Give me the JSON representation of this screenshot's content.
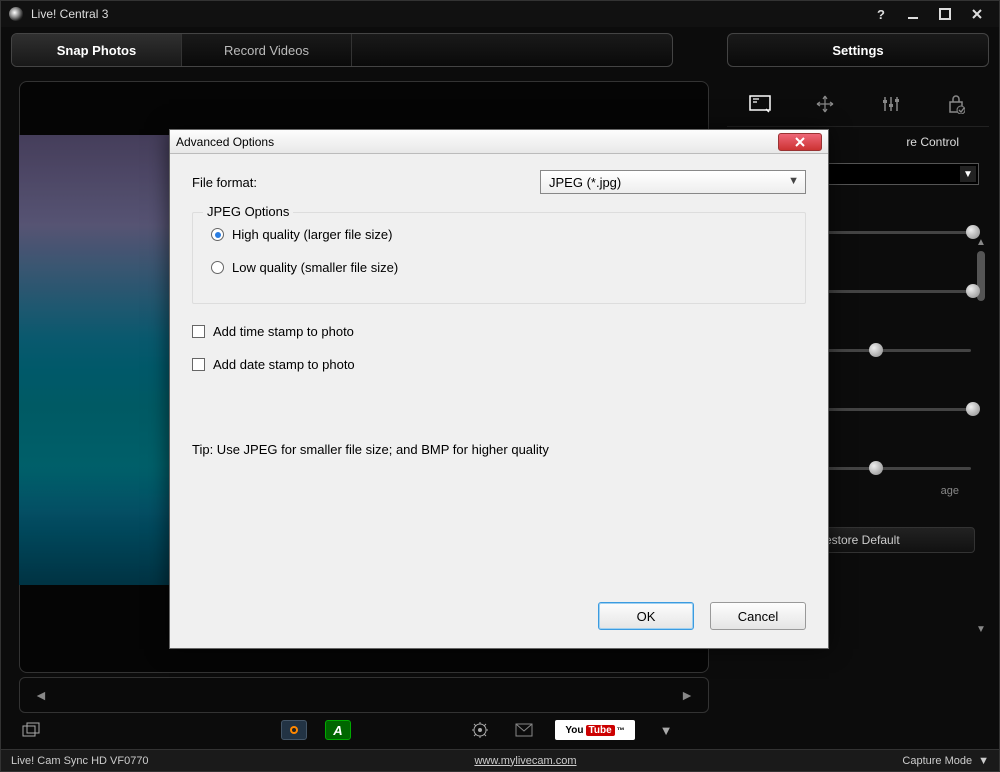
{
  "app": {
    "title": "Live! Central 3"
  },
  "tabs": {
    "snap": "Snap Photos",
    "record": "Record Videos",
    "settings": "Settings"
  },
  "settings_panel": {
    "section": "re Control",
    "restore": "Restore Default",
    "partial_label": "age"
  },
  "dialog": {
    "title": "Advanced Options",
    "file_format_label": "File format:",
    "file_format_value": "JPEG (*.jpg)",
    "group_legend": "JPEG Options",
    "radio_high": "High quality (larger file size)",
    "radio_low": "Low quality (smaller file size)",
    "check_time": "Add time stamp to photo",
    "check_date": "Add date stamp to photo",
    "tip": "Tip: Use JPEG for smaller file size; and BMP for higher quality",
    "ok": "OK",
    "cancel": "Cancel"
  },
  "bottom": {
    "youtube": "You",
    "youtube_tube": "Tube",
    "tm": "™"
  },
  "status": {
    "device": "Live! Cam Sync HD VF0770",
    "url": "www.mylivecam.com",
    "capture": "Capture Mode"
  },
  "sliders": {
    "positions": [
      98,
      98,
      55,
      98,
      55
    ]
  }
}
